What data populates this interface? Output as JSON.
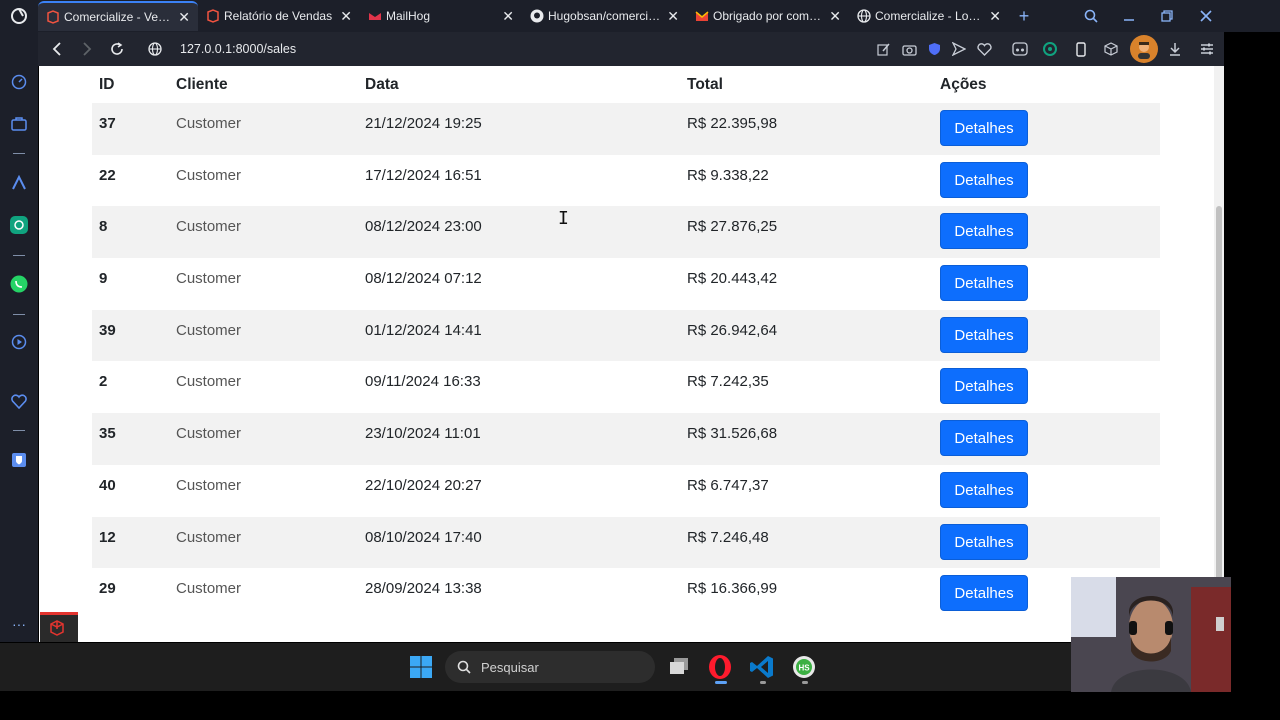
{
  "browser": {
    "tabs": [
      {
        "title": "Comercialize - Vendas",
        "icon": "laravel-icon",
        "active": true
      },
      {
        "title": "Relatório de Vendas",
        "icon": "laravel-icon",
        "active": false
      },
      {
        "title": "MailHog",
        "icon": "mailhog-icon",
        "active": false
      },
      {
        "title": "Hugobsan/comercialize",
        "icon": "github-icon",
        "active": false
      },
      {
        "title": "Obrigado por compra",
        "icon": "gmail-icon",
        "active": false
      },
      {
        "title": "Comercialize - Login",
        "icon": "globe-icon",
        "active": false
      }
    ],
    "url": "127.0.0.1:8000/sales"
  },
  "table": {
    "headers": [
      "ID",
      "Cliente",
      "Data",
      "Total",
      "Ações"
    ],
    "button_label": "Detalhes",
    "rows": [
      {
        "id": "37",
        "cliente": "Customer",
        "data": "21/12/2024 19:25",
        "total": "R$ 22.395,98"
      },
      {
        "id": "22",
        "cliente": "Customer",
        "data": "17/12/2024 16:51",
        "total": "R$ 9.338,22"
      },
      {
        "id": "8",
        "cliente": "Customer",
        "data": "08/12/2024 23:00",
        "total": "R$ 27.876,25"
      },
      {
        "id": "9",
        "cliente": "Customer",
        "data": "08/12/2024 07:12",
        "total": "R$ 20.443,42"
      },
      {
        "id": "39",
        "cliente": "Customer",
        "data": "01/12/2024 14:41",
        "total": "R$ 26.942,64"
      },
      {
        "id": "2",
        "cliente": "Customer",
        "data": "09/11/2024 16:33",
        "total": "R$ 7.242,35"
      },
      {
        "id": "35",
        "cliente": "Customer",
        "data": "23/10/2024 11:01",
        "total": "R$ 31.526,68"
      },
      {
        "id": "40",
        "cliente": "Customer",
        "data": "22/10/2024 20:27",
        "total": "R$ 6.747,37"
      },
      {
        "id": "12",
        "cliente": "Customer",
        "data": "08/10/2024 17:40",
        "total": "R$ 7.246,48"
      },
      {
        "id": "29",
        "cliente": "Customer",
        "data": "28/09/2024 13:38",
        "total": "R$ 16.366,99"
      }
    ]
  },
  "taskbar": {
    "search_label": "Pesquisar",
    "apps": [
      "windows-start-icon",
      "task-view-icon",
      "opera-icon",
      "vscode-icon",
      "hs-app-icon"
    ]
  },
  "colors": {
    "accent": "#0d6efd",
    "tab_accent": "#3b82f6",
    "stripe": "#f2f2f2"
  }
}
